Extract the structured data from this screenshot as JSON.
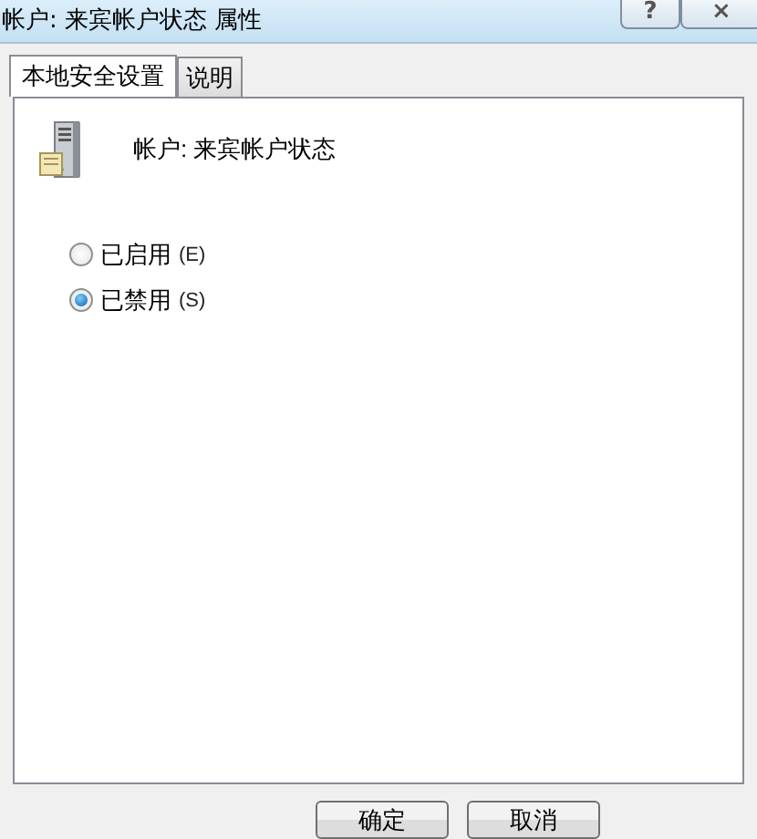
{
  "window": {
    "title": "帐户: 来宾帐户状态 属性",
    "help_button": "?",
    "close_button": "×"
  },
  "tabs": [
    {
      "label": "本地安全设置",
      "selected": true
    },
    {
      "label": "说明",
      "selected": false
    }
  ],
  "policy": {
    "name": "帐户: 来宾帐户状态"
  },
  "options": [
    {
      "label": "已启用",
      "access_key": "(E)",
      "selected": false
    },
    {
      "label": "已禁用",
      "access_key": "(S)",
      "selected": true
    }
  ],
  "buttons": [
    "确定",
    "取消"
  ]
}
